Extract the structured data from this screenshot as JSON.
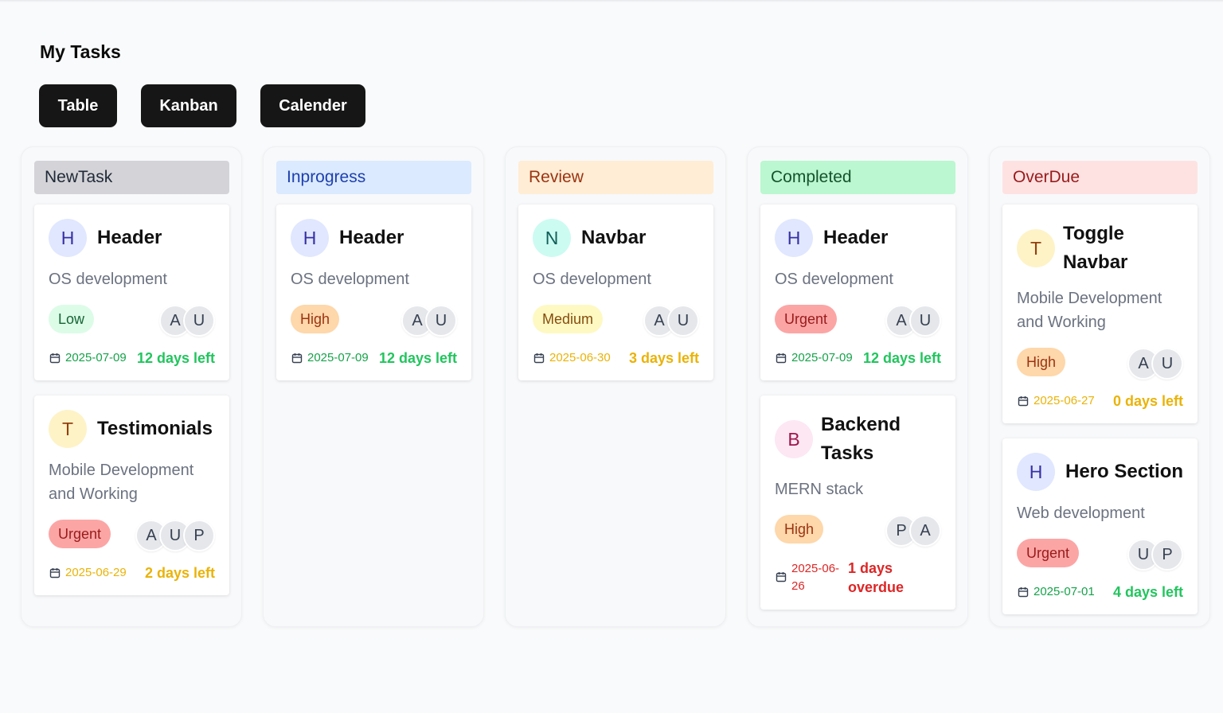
{
  "page": {
    "title": "My Tasks"
  },
  "views": {
    "table": "Table",
    "kanban": "Kanban",
    "calendar": "Calender"
  },
  "columns": [
    {
      "title": "NewTask",
      "header_bg": "#d4d4d8",
      "header_color": "#1f2937",
      "cards": [
        {
          "avatar_letter": "H",
          "avatar_bg": "#e0e7ff",
          "avatar_color": "#3730a3",
          "title": "Header",
          "desc": "OS development",
          "priority": "Low",
          "priority_bg": "#dcfce7",
          "priority_color": "#166534",
          "assignees": [
            "A",
            "U"
          ],
          "date": "2025-07-09",
          "date_color": "#16a34a",
          "days": "12 days left",
          "days_color": "#22c55e"
        },
        {
          "avatar_letter": "T",
          "avatar_bg": "#fef3c7",
          "avatar_color": "#92400e",
          "title": "Testimonials",
          "desc": "Mobile Development and Working",
          "priority": "Urgent",
          "priority_bg": "#fca5a5",
          "priority_color": "#991b1b",
          "assignees": [
            "A",
            "U",
            "P"
          ],
          "date": "2025-06-29",
          "date_color": "#eab308",
          "days": "2 days left",
          "days_color": "#eab308"
        }
      ]
    },
    {
      "title": "Inprogress",
      "header_bg": "#dbeafe",
      "header_color": "#1e40af",
      "cards": [
        {
          "avatar_letter": "H",
          "avatar_bg": "#e0e7ff",
          "avatar_color": "#3730a3",
          "title": "Header",
          "desc": "OS development",
          "priority": "High",
          "priority_bg": "#fed7aa",
          "priority_color": "#9a3412",
          "assignees": [
            "A",
            "U"
          ],
          "date": "2025-07-09",
          "date_color": "#16a34a",
          "days": "12 days left",
          "days_color": "#22c55e"
        }
      ]
    },
    {
      "title": "Review",
      "header_bg": "#ffedd5",
      "header_color": "#9a3412",
      "cards": [
        {
          "avatar_letter": "N",
          "avatar_bg": "#ccfbf1",
          "avatar_color": "#115e59",
          "title": "Navbar",
          "desc": "OS development",
          "priority": "Medium",
          "priority_bg": "#fef9c3",
          "priority_color": "#854d0e",
          "assignees": [
            "A",
            "U"
          ],
          "date": "2025-06-30",
          "date_color": "#eab308",
          "days": "3 days left",
          "days_color": "#eab308"
        }
      ]
    },
    {
      "title": "Completed",
      "header_bg": "#bbf7d0",
      "header_color": "#14532d",
      "cards": [
        {
          "avatar_letter": "H",
          "avatar_bg": "#e0e7ff",
          "avatar_color": "#3730a3",
          "title": "Header",
          "desc": "OS development",
          "priority": "Urgent",
          "priority_bg": "#fca5a5",
          "priority_color": "#991b1b",
          "assignees": [
            "A",
            "U"
          ],
          "date": "2025-07-09",
          "date_color": "#16a34a",
          "days": "12 days left",
          "days_color": "#22c55e"
        },
        {
          "avatar_letter": "B",
          "avatar_bg": "#fce7f3",
          "avatar_color": "#9d174d",
          "title": "Backend Tasks",
          "desc": "MERN stack",
          "priority": "High",
          "priority_bg": "#fed7aa",
          "priority_color": "#9a3412",
          "assignees": [
            "P",
            "A"
          ],
          "date": "2025-06-26",
          "date_color": "#dc2626",
          "days": "1 days overdue",
          "days_color": "#dc2626"
        }
      ]
    },
    {
      "title": "OverDue",
      "header_bg": "#fee2e2",
      "header_color": "#991b1b",
      "cards": [
        {
          "avatar_letter": "T",
          "avatar_bg": "#fef3c7",
          "avatar_color": "#92400e",
          "title": "Toggle Navbar",
          "desc": "Mobile Development and Working",
          "priority": "High",
          "priority_bg": "#fed7aa",
          "priority_color": "#9a3412",
          "assignees": [
            "A",
            "U"
          ],
          "date": "2025-06-27",
          "date_color": "#eab308",
          "days": "0 days left",
          "days_color": "#eab308"
        },
        {
          "avatar_letter": "H",
          "avatar_bg": "#e0e7ff",
          "avatar_color": "#3730a3",
          "title": "Hero Section",
          "desc": "Web development",
          "priority": "Urgent",
          "priority_bg": "#fca5a5",
          "priority_color": "#991b1b",
          "assignees": [
            "U",
            "P"
          ],
          "date": "2025-07-01",
          "date_color": "#16a34a",
          "days": "4 days left",
          "days_color": "#22c55e"
        }
      ]
    }
  ]
}
